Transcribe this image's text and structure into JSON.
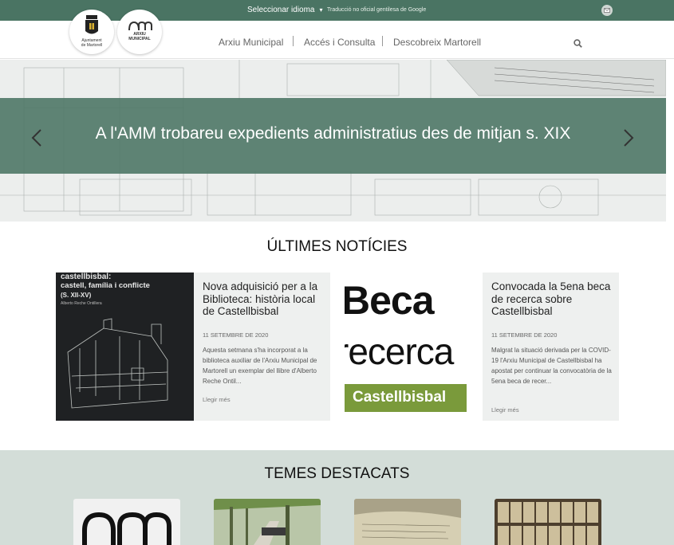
{
  "topbar": {
    "language_select": "Seleccionar idioma",
    "translation_note": "Traducció no oficial gentilesa de Google"
  },
  "logos": {
    "ajuntament": [
      "Ajuntament",
      "de Martorell"
    ],
    "arxiu": [
      "ARXIU",
      "MUNICIPAL"
    ]
  },
  "nav": {
    "items": [
      "Arxiu Municipal",
      "Accés i Consulta",
      "Descobreix Martorell"
    ]
  },
  "hero": {
    "headline": "A l'AMM trobareu expedients administratius des de mitjan s. XIX"
  },
  "news": {
    "title": "ÚLTIMES NOTÍCIES",
    "cards": [
      {
        "title": "Nova adquisició per a la Biblioteca: història local de Castellbisbal",
        "date": "11 SETEMBRE DE 2020",
        "body": "Aquesta setmana s'ha incorporat a la biblioteca auxiliar de l'Arxiu Municipal de Martorell un exemplar del llibre d'Alberto Reche Ontil...",
        "more": "Llegir més",
        "image_text": [
          "castellbisbal:",
          "castell, família i conflicte",
          "(S. XII-XV)",
          "Alberto Reche Ontillera"
        ]
      },
      {
        "title": "Convocada la 5ena beca de recerca sobre Castellbisbal",
        "date": "11 SETEMBRE DE 2020",
        "body": "Malgrat la situació derivada per la COVID-19 l'Arxiu Municipal de Castellbisbal ha apostat per continuar la convocatòria de la 5ena beca de recer...",
        "more": "Llegir més",
        "image_text": [
          "Beca",
          "recerca",
          "Castellbisbal"
        ]
      }
    ]
  },
  "featured": {
    "title": "TEMES DESTACATS"
  },
  "colors": {
    "brand_green": "#4a7463",
    "featured_bg": "#d3ddd8",
    "card_bg": "#eef0ef"
  }
}
